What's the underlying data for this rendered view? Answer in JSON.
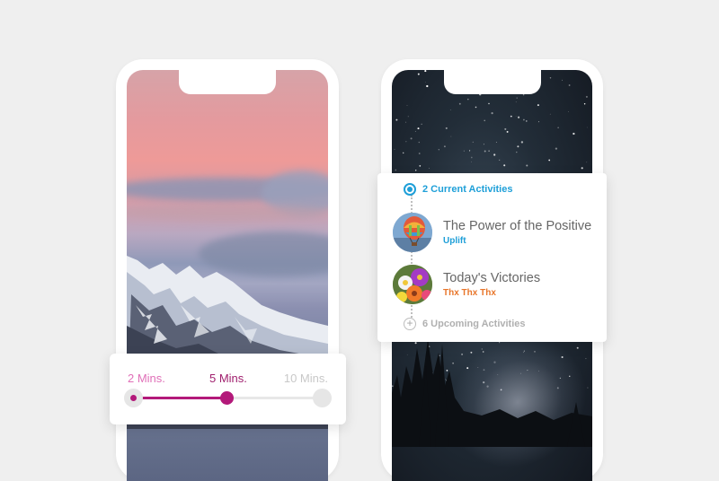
{
  "duration_slider": {
    "options": [
      "2 Mins.",
      "5 Mins.",
      "10 Mins."
    ],
    "selected": "5 Mins."
  },
  "activities": {
    "current_label": "2 Current Activities",
    "items": [
      {
        "title": "The Power of the Positive",
        "subtitle": "Uplift",
        "thumbnail": "hot-air-balloon"
      },
      {
        "title": "Today's Victories",
        "subtitle": "Thx Thx Thx",
        "thumbnail": "flowers"
      }
    ],
    "upcoming_label": "6 Upcoming Activities"
  },
  "colors": {
    "background": "#efefef",
    "slider_accent": "#b3197a",
    "current_accent": "#1e9fd8",
    "secondary_accent": "#e8762b"
  },
  "icons": [
    "current-ring-icon",
    "plus-circle-icon"
  ]
}
